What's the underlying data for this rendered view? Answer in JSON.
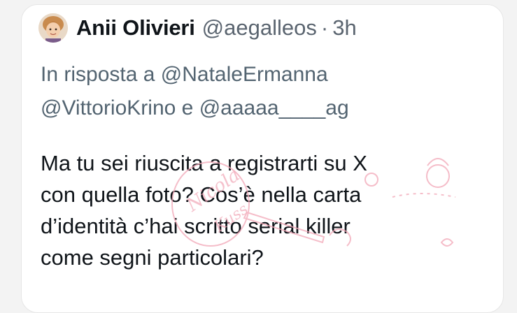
{
  "tweet": {
    "author": {
      "display_name": "Anii Olivieri",
      "handle": "@aegalleos",
      "separator": "·",
      "time": "3h",
      "avatar_icon": "child-avatar"
    },
    "reply_context": {
      "prefix": "In risposta a ",
      "mention_1": "@NataleErmanna",
      "mention_2": "@VittorioKrino",
      "conjunction": " e ",
      "mention_3": "@aaaaa____ag"
    },
    "text": "Ma tu sei riuscita a registrarti su X\ncon quella foto? Cos’è nella carta\nd’identità c’hai scritto serial killer\ncome segni particolari?"
  },
  "watermark": {
    "text": "Nicola Kuss",
    "color": "#f2a7b7"
  },
  "colors": {
    "primary_text": "#0f1419",
    "secondary_text": "#536471",
    "card_background": "#ffffff"
  }
}
